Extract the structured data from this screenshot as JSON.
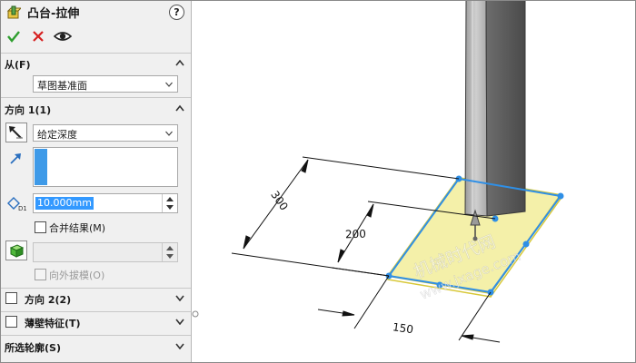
{
  "feature": {
    "title": "凸台-拉伸",
    "help": "?"
  },
  "from": {
    "label": "从(F)",
    "value": "草图基准面"
  },
  "direction1": {
    "label": "方向 1(1)",
    "end_condition": "给定深度",
    "depth": "10.000mm",
    "merge_label": "合并结果(M)",
    "draft_label": "向外拔模(O)"
  },
  "direction2": {
    "label": "方向 2(2)"
  },
  "thin": {
    "label": "薄壁特征(T)"
  },
  "contours": {
    "label": "所选轮廓(S)"
  },
  "viewport": {
    "dim_300": "300",
    "dim_200": "200",
    "dim_150": "150",
    "watermark_cn": "机械时代网",
    "watermark_url": "www.jxage.com"
  },
  "colors": {
    "accent": "#3e9ae8",
    "sketch_fill": "#f3eea0",
    "sketch_edge": "#d8c838",
    "selection": "#2f8fe6",
    "ok": "#2e9e2e",
    "cancel": "#d62020"
  },
  "icons": [
    "feature-extrude-icon",
    "help-icon",
    "ok-check-icon",
    "cancel-x-icon",
    "preview-eye-icon",
    "reverse-direction-icon",
    "direction-vector-icon",
    "depth-icon",
    "solid-body-icon",
    "chevron-up-icon",
    "chevron-down-icon"
  ]
}
